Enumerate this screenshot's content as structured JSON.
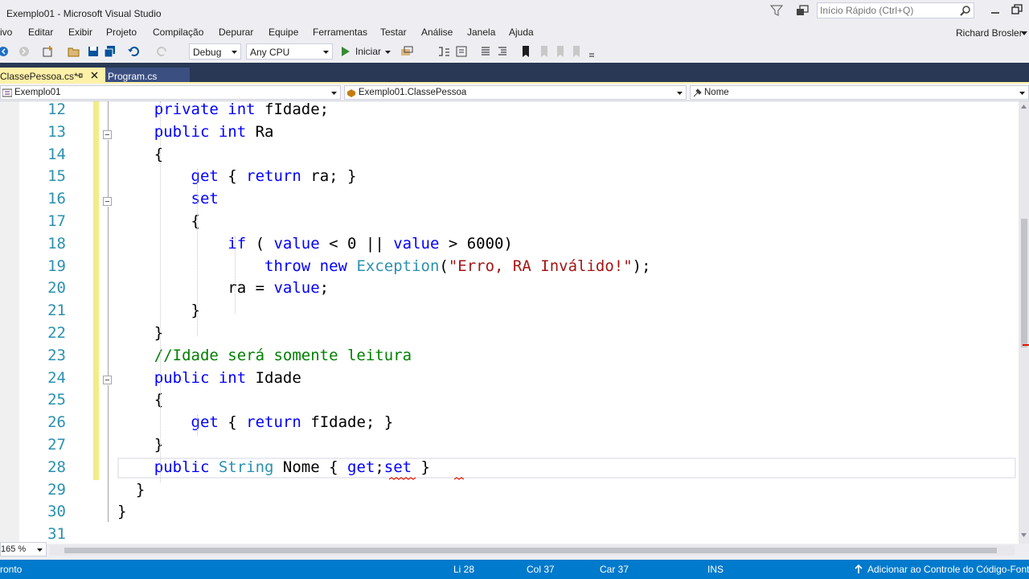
{
  "window": {
    "title": "Exemplo01 - Microsoft Visual Studio",
    "quick_launch_placeholder": "Início Rápido (Ctrl+Q)",
    "user": "Richard Brosler"
  },
  "menu": [
    "ivo",
    "Editar",
    "Exibir",
    "Projeto",
    "Compilação",
    "Depurar",
    "Equipe",
    "Ferramentas",
    "Testar",
    "Análise",
    "Janela",
    "Ajuda"
  ],
  "toolbar": {
    "configuration": "Debug",
    "platform": "Any CPU",
    "start_label": "Iniciar"
  },
  "tabs": {
    "active": "ClassePessoa.cs*",
    "inactive": "Program.cs"
  },
  "navbar": {
    "project": "Exemplo01",
    "class": "Exemplo01.ClassePessoa",
    "member": "Nome"
  },
  "code_lines": [
    {
      "num": "12",
      "tokens": [
        {
          "t": "    private ",
          "c": "kw"
        },
        {
          "t": "int",
          "c": "kw"
        },
        {
          "t": " fIdade;",
          "c": ""
        }
      ]
    },
    {
      "num": "13",
      "tokens": [
        {
          "t": "    public ",
          "c": "kw"
        },
        {
          "t": "int",
          "c": "kw"
        },
        {
          "t": " Ra",
          "c": ""
        }
      ]
    },
    {
      "num": "14",
      "tokens": [
        {
          "t": "    {",
          "c": ""
        }
      ]
    },
    {
      "num": "15",
      "tokens": [
        {
          "t": "        get",
          "c": "kw"
        },
        {
          "t": " { ",
          "c": ""
        },
        {
          "t": "return",
          "c": "kw"
        },
        {
          "t": " ra; }",
          "c": ""
        }
      ]
    },
    {
      "num": "16",
      "tokens": [
        {
          "t": "        set",
          "c": "kw"
        }
      ]
    },
    {
      "num": "17",
      "tokens": [
        {
          "t": "        {",
          "c": ""
        }
      ]
    },
    {
      "num": "18",
      "tokens": [
        {
          "t": "            if",
          "c": "kw"
        },
        {
          "t": " ( ",
          "c": ""
        },
        {
          "t": "value",
          "c": "kw"
        },
        {
          "t": " < 0 || ",
          "c": ""
        },
        {
          "t": "value",
          "c": "kw"
        },
        {
          "t": " > 6000)",
          "c": ""
        }
      ]
    },
    {
      "num": "19",
      "tokens": [
        {
          "t": "                throw",
          "c": "kw"
        },
        {
          "t": " ",
          "c": ""
        },
        {
          "t": "new",
          "c": "kw"
        },
        {
          "t": " ",
          "c": ""
        },
        {
          "t": "Exception",
          "c": "ty"
        },
        {
          "t": "(",
          "c": ""
        },
        {
          "t": "\"Erro, RA Inválido!\"",
          "c": "str"
        },
        {
          "t": ");",
          "c": ""
        }
      ]
    },
    {
      "num": "20",
      "tokens": [
        {
          "t": "            ra = ",
          "c": ""
        },
        {
          "t": "value",
          "c": "kw"
        },
        {
          "t": ";",
          "c": ""
        }
      ]
    },
    {
      "num": "21",
      "tokens": [
        {
          "t": "        }",
          "c": ""
        }
      ]
    },
    {
      "num": "22",
      "tokens": [
        {
          "t": "    }",
          "c": ""
        }
      ]
    },
    {
      "num": "23",
      "tokens": [
        {
          "t": "    //Idade será somente leitura",
          "c": "cm"
        }
      ]
    },
    {
      "num": "24",
      "tokens": [
        {
          "t": "    public ",
          "c": "kw"
        },
        {
          "t": "int",
          "c": "kw"
        },
        {
          "t": " Idade",
          "c": ""
        }
      ]
    },
    {
      "num": "25",
      "tokens": [
        {
          "t": "    {",
          "c": ""
        }
      ]
    },
    {
      "num": "26",
      "tokens": [
        {
          "t": "        get",
          "c": "kw"
        },
        {
          "t": " { ",
          "c": ""
        },
        {
          "t": "return",
          "c": "kw"
        },
        {
          "t": " fIdade; }",
          "c": ""
        }
      ]
    },
    {
      "num": "27",
      "tokens": [
        {
          "t": "    }",
          "c": ""
        }
      ]
    },
    {
      "num": "28",
      "tokens": [
        {
          "t": "    public ",
          "c": "kw"
        },
        {
          "t": "String",
          "c": "ty"
        },
        {
          "t": " Nome { ",
          "c": ""
        },
        {
          "t": "get",
          "c": "kw"
        },
        {
          "t": ";",
          "c": ""
        },
        {
          "t": "set",
          "c": "kw"
        },
        {
          "t": " }",
          "c": ""
        }
      ]
    },
    {
      "num": "29",
      "tokens": [
        {
          "t": "  }",
          "c": ""
        }
      ]
    },
    {
      "num": "30",
      "tokens": [
        {
          "t": "}",
          "c": ""
        }
      ]
    },
    {
      "num": "31",
      "tokens": []
    }
  ],
  "editor_footer": {
    "zoom": "165 %"
  },
  "status": {
    "ready": "ronto",
    "line": "Li 28",
    "col": "Col 37",
    "car": "Car 37",
    "mode": "INS",
    "source_control": "Adicionar ao Controle do Código-Font"
  },
  "colors": {
    "status_bar": "#007acc",
    "tab_strip": "#293955",
    "active_tab": "#fff1a8",
    "keyword": "#0000ff",
    "type": "#2b91af",
    "string": "#a31515",
    "comment": "#008000"
  }
}
